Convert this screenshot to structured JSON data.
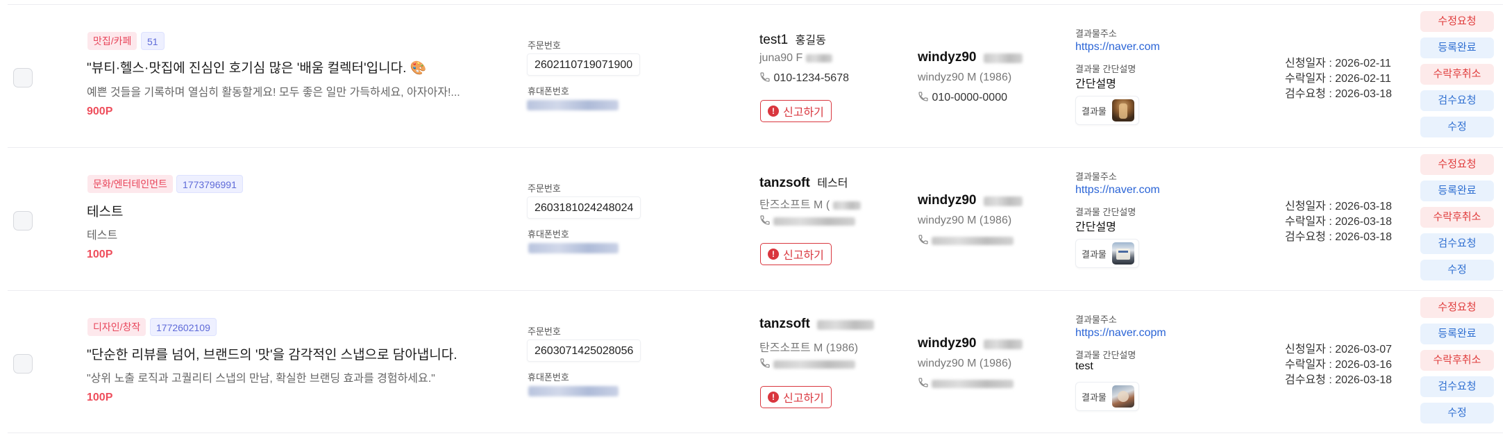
{
  "rows": [
    {
      "category": "맛집/카페",
      "post_id": "51",
      "title": "\"뷰티·헬스·맛집에 진심인 호기심 많은 '배움 컬렉터'입니다. 🎨",
      "description": "예쁜 것들을 기록하며 열심히 활동할게요! 모두 좋은 일만 가득하세요, 아자아자!...",
      "points": "900P",
      "order_label": "주문번호",
      "order_number": "2602110719071900",
      "phone_label": "휴대폰번호",
      "requester_id": "test1",
      "requester_name": "홍길동",
      "requester_info": "juna90 F",
      "requester_phone": "010-1234-5678",
      "report_label": "신고하기",
      "receiver_id": "windyz90",
      "receiver_info": "windyz90 M (1986)",
      "receiver_phone": "010-0000-0000",
      "result_url_label": "결과물주소",
      "result_url": "https://naver.com",
      "result_desc_label": "결과물 간단설명",
      "result_desc": "간단설명",
      "result_label": "결과물",
      "dates": [
        "신청일자 : 2026-02-11",
        "수락일자 : 2026-02-11",
        "검수요청 : 2026-03-18"
      ]
    },
    {
      "category": "문화/엔터테인먼트",
      "post_id": "1773796991",
      "title": "테스트",
      "description": "테스트",
      "points": "100P",
      "order_label": "주문번호",
      "order_number": "2603181024248024",
      "phone_label": "휴대폰번호",
      "requester_id": "tanzsoft",
      "requester_name": "테스터",
      "requester_info": "탄즈소프트 M (",
      "requester_phone": "",
      "report_label": "신고하기",
      "receiver_id": "windyz90",
      "receiver_info": "windyz90 M (1986)",
      "receiver_phone": "",
      "result_url_label": "결과물주소",
      "result_url": "https://naver.com",
      "result_desc_label": "결과물 간단설명",
      "result_desc": "간단설명",
      "result_label": "결과물",
      "dates": [
        "신청일자 : 2026-03-18",
        "수락일자 : 2026-03-18",
        "검수요청 : 2026-03-18"
      ]
    },
    {
      "category": "디자인/창작",
      "post_id": "1772602109",
      "title": "\"단순한 리뷰를 넘어, 브랜드의 '맛'을 감각적인 스냅으로 담아냅니다.",
      "description": "\"상위 노출 로직과 고퀄리티 스냅의 만남, 확실한 브랜딩 효과를 경험하세요.\"",
      "points": "100P",
      "order_label": "주문번호",
      "order_number": "2603071425028056",
      "phone_label": "휴대폰번호",
      "requester_id": "tanzsoft",
      "requester_name": "",
      "requester_info": "탄즈소프트 M (1986)",
      "requester_phone": "",
      "report_label": "신고하기",
      "receiver_id": "windyz90",
      "receiver_info": "windyz90 M (1986)",
      "receiver_phone": "",
      "result_url_label": "결과물주소",
      "result_url": "https://naver.copm",
      "result_desc_label": "결과물 간단설명",
      "result_desc": "test",
      "result_label": "결과물",
      "dates": [
        "신청일자 : 2026-03-07",
        "수락일자 : 2026-03-16",
        "검수요청 : 2026-03-18"
      ]
    }
  ],
  "actions": {
    "edit_request": "수정요청",
    "registration_complete": "등록완료",
    "cancel_acceptance": "수락후취소",
    "inspection_request": "검수요청",
    "edit": "수정"
  },
  "icons": {
    "phone": "phone-icon",
    "alert": "alert-circle-icon",
    "checkbox": "checkbox-icon"
  },
  "colors": {
    "accent_red": "#e03b3b",
    "accent_blue": "#2f6fd1",
    "points": "#ee4d5b",
    "link": "#2a64d6"
  }
}
